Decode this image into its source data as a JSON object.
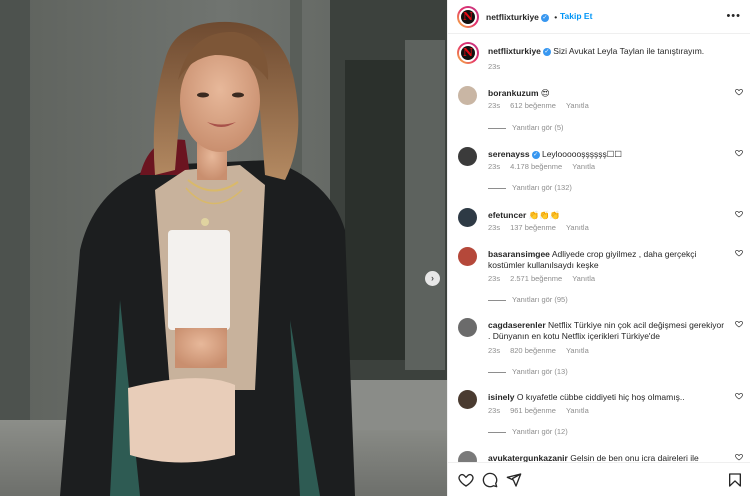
{
  "post": {
    "account": "netflixturkiye",
    "follow_label": "Takip Et",
    "more_label": "•••",
    "caption": "Sizi Avukat Leyla Taylan ile tanıştırayım.",
    "caption_time": "23s"
  },
  "comments": [
    {
      "user": "borankuzum",
      "text": "😍",
      "time": "23s",
      "likes": "612 beğenme",
      "reply": "Yanıtla",
      "replies": "Yanıtları gör (5)",
      "avatar_color": "#c9b6a4"
    },
    {
      "user": "serenayss",
      "verified": true,
      "text": "Leyloooooşşşşşş☐☐",
      "time": "23s",
      "likes": "4.178 beğenme",
      "reply": "Yanıtla",
      "replies": "Yanıtları gör (132)",
      "avatar_color": "#3b3b3b"
    },
    {
      "user": "efetuncer",
      "text": "👏👏👏",
      "time": "23s",
      "likes": "137 beğenme",
      "reply": "Yanıtla",
      "replies": "",
      "avatar_color": "#2e3a45"
    },
    {
      "user": "basaransimgee",
      "text": "Adliyede crop giyilmez , daha gerçekçi kostümler kullanılsaydı keşke",
      "time": "23s",
      "likes": "2.571 beğenme",
      "reply": "Yanıtla",
      "replies": "Yanıtları gör (95)",
      "avatar_color": "#b5483a"
    },
    {
      "user": "cagdaserenler",
      "text": "Netflix Türkiye nin çok acil değişmesi gerekiyor . Dünyanın en kotu Netflix içerikleri Türkiye'de",
      "time": "23s",
      "likes": "820 beğenme",
      "reply": "Yanıtla",
      "replies": "Yanıtları gör (13)",
      "avatar_color": "#6b6b6b"
    },
    {
      "user": "isinely",
      "text": "O kıyafetle cübbe ciddiyeti hiç hoş olmamış..",
      "time": "23s",
      "likes": "961 beğenme",
      "reply": "Yanıtla",
      "replies": "Yanıtları gör (12)",
      "avatar_color": "#4a3b30"
    },
    {
      "user": "avukatergunkazanir",
      "text": "Gelsin de ben onu icra daireleri ile",
      "time": "",
      "likes": "",
      "reply": "",
      "replies": "",
      "avatar_color": "#7a7a7a"
    }
  ],
  "colors": {
    "accent": "#0095f6",
    "muted": "#8e8e8e",
    "netflix_red": "#e50914"
  },
  "icons": [
    "heart-icon",
    "comment-icon",
    "share-icon",
    "bookmark-icon",
    "chevron-right-icon",
    "verified-icon",
    "more-icon"
  ]
}
